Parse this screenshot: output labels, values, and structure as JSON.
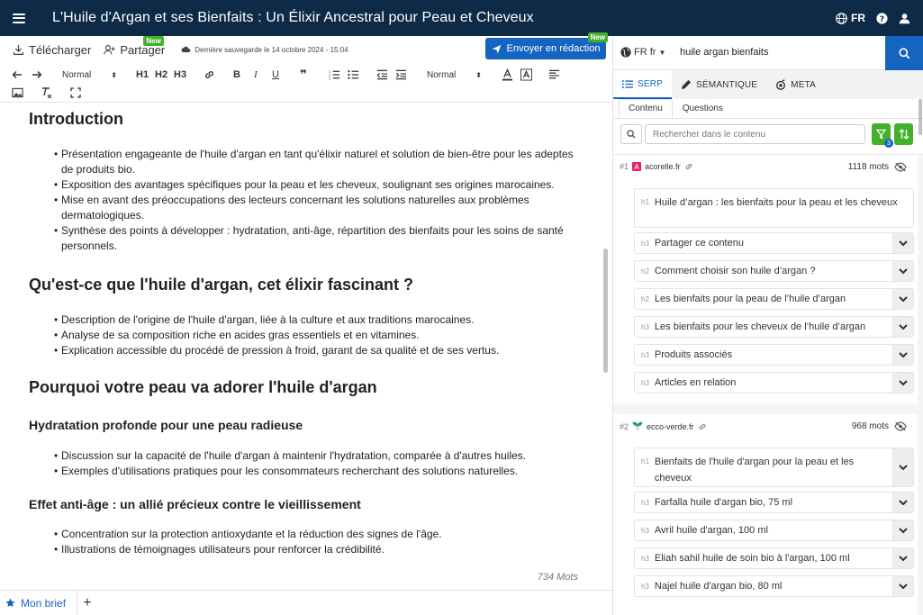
{
  "header": {
    "title": "L'Huile d'Argan et ses Bienfaits : Un Élixir Ancestral pour Peau et Cheveux",
    "lang_label": "FR"
  },
  "actions": {
    "download": "Télécharger",
    "share": "Partager",
    "new_badge": "New",
    "save_info": "Dernière sauvegarde le 14 octobre 2024 - 15:04",
    "send": "Envoyer en rédaction"
  },
  "format": {
    "style_select": "Normal",
    "size_select": "Normal",
    "h1": "H1",
    "h2": "H2",
    "h3": "H3",
    "bold": "B",
    "italic": "I",
    "underline": "U",
    "quote": "❞"
  },
  "editor": {
    "sections": [
      {
        "h2": "Introduction",
        "bullets": [
          "Présentation engageante de l'huile d'argan en tant qu'élixir naturel et solution de bien-être pour les adeptes de produits bio.",
          "Exposition des avantages spécifiques pour la peau et les cheveux, soulignant ses origines marocaines.",
          "Mise en avant des préoccupations des lecteurs concernant les solutions naturelles aux problèmes dermatologiques.",
          "Synthèse des points à développer : hydratation, anti-âge, répartition des bienfaits pour les soins de santé personnels."
        ]
      },
      {
        "h2": "Qu'est-ce que l'huile d'argan, cet élixir fascinant ?",
        "bullets": [
          "Description de l'origine de l'huile d'argan, liée à la culture et aux traditions marocaines.",
          "Analyse de sa composition riche en acides gras essentiels et en vitamines.",
          "Explication accessible du procédé de pression à froid, garant de sa qualité et de ses vertus."
        ]
      },
      {
        "h2": "Pourquoi votre peau va adorer l'huile d'argan"
      },
      {
        "h3": "Hydratation profonde pour une peau radieuse",
        "bullets": [
          "Discussion sur la capacité de l'huile d'argan à maintenir l'hydratation, comparée à d'autres huiles.",
          "Exemples d'utilisations pratiques pour les consommateurs recherchant des solutions naturelles."
        ]
      },
      {
        "h3": "Effet anti-âge : un allié précieux contre le vieillissement",
        "bullets": [
          "Concentration sur la protection antioxydante et la réduction des signes de l'âge.",
          "Illustrations de témoignages utilisateurs pour renforcer la crédibilité."
        ]
      }
    ],
    "word_count": "734 Mots"
  },
  "bottom": {
    "tab_brief": "Mon brief",
    "add": "+"
  },
  "panel": {
    "lang_select": "FR fr",
    "keyword": "huile argan bienfaits",
    "tabs": [
      "SERP",
      "SÉMANTIQUE",
      "META"
    ],
    "subtabs": [
      "Contenu",
      "Questions"
    ],
    "filter_placeholder": "Rechercher dans le contenu",
    "filter_count": "3",
    "results": [
      {
        "rank": "#1",
        "domain": "acorelle.fr",
        "words": "1118 mots",
        "headings": [
          {
            "tag": "h1",
            "text": "Huile d’argan : les bienfaits pour la peau et les cheveux"
          },
          {
            "tag": "h3",
            "text": "Partager ce contenu"
          },
          {
            "tag": "h2",
            "text": "Comment choisir son huile d’argan ?"
          },
          {
            "tag": "h2",
            "text": "Les bienfaits pour la peau de l’huile d’argan"
          },
          {
            "tag": "h3",
            "text": "Les bienfaits pour les cheveux de l’huile d’argan"
          },
          {
            "tag": "h3",
            "text": "Produits associés"
          },
          {
            "tag": "h3",
            "text": "Articles en relation"
          }
        ]
      },
      {
        "rank": "#2",
        "domain": "ecco-verde.fr",
        "words": "968 mots",
        "headings": [
          {
            "tag": "h1",
            "text": "Bienfaits de l'huile d'argan pour la peau et les cheveux"
          },
          {
            "tag": "h3",
            "text": "Farfalla huile d'argan bio, 75 ml"
          },
          {
            "tag": "h3",
            "text": "Avril huile d'argan, 100 ml"
          },
          {
            "tag": "h3",
            "text": "Eliah sahil huile de soin bio à l'argan, 100 ml"
          },
          {
            "tag": "h3",
            "text": "Najel huile d'argan bio, 80 ml"
          }
        ]
      }
    ]
  },
  "colors": {
    "topbar": "#0e2a47",
    "primary": "#1565c0",
    "green": "#43b02a"
  }
}
